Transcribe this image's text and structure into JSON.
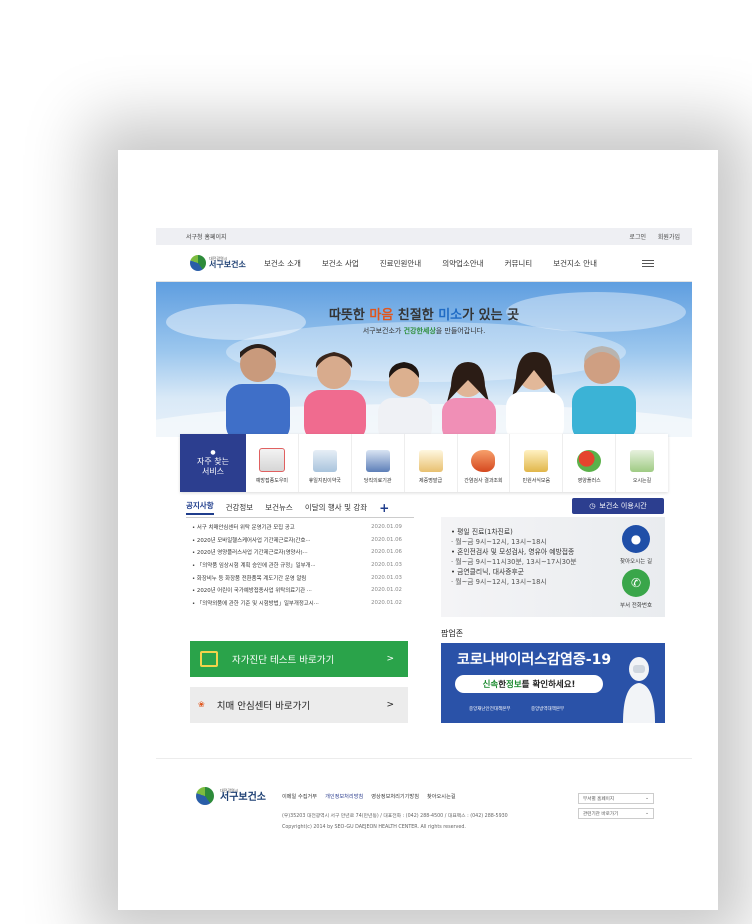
{
  "topbar": {
    "left": "서구청 홈페이지",
    "login": "로그인",
    "join": "회원가입"
  },
  "logo": {
    "small": "대전광역시",
    "name": "서구보건소"
  },
  "menu": [
    "보건소 소개",
    "보건소 사업",
    "진료민원안내",
    "의약업소안내",
    "커뮤니티",
    "보건지소 안내"
  ],
  "hero": {
    "title_a": "따뜻한 ",
    "title_b": "마음",
    "title_c": " 친절한 ",
    "title_d": "미소",
    "title_e": "가 있는 곳",
    "sub_a": "서구보건소가 ",
    "sub_b": "건강한세상",
    "sub_c": "을 만들어갑니다."
  },
  "quick": {
    "title_1": "자주 찾는",
    "title_2": "서비스",
    "items": [
      "예방접종도우미",
      "휴일지킴이약국",
      "당직의료기관",
      "제증명발급",
      "간염검사 결과조회",
      "민원서식모음",
      "영양플러스",
      "오시는길"
    ]
  },
  "tabs": [
    "공지사항",
    "건강정보",
    "보건뉴스",
    "이달의 행사 및 강좌"
  ],
  "tab_plus": "+",
  "news": [
    {
      "title": "서구 치매안심센터 위탁 운영기관 모집 공고",
      "date": "2020.01.09"
    },
    {
      "title": "2020년 모바일헬스케어사업 기간제근로자(간호···",
      "date": "2020.01.06"
    },
    {
      "title": "2020년 영양플러스사업 기간제근로자(영양사)···",
      "date": "2020.01.06"
    },
    {
      "title": "「의약품 임상시험 계획 승인에 관한 규정」일부개···",
      "date": "2020.01.03"
    },
    {
      "title": "화장비누 등 화장품 전환품목 계도기간 운영 알림",
      "date": "2020.01.03"
    },
    {
      "title": "2020년 어린이 국가예방접종사업 위탁의료기관 ···",
      "date": "2020.01.02"
    },
    {
      "title": "「의약외품에 관한 기준 및 시험방법」일부개정고시···",
      "date": "2020.01.02"
    }
  ],
  "hours": {
    "button": "보건소 이용시간",
    "l1": "• 평일 진료(1차진료)",
    "l2": "· 월~금 9시~12시, 13시~18시",
    "l3": "• 혼인전검사 및 모성검사, 영유아 예방접종",
    "l4": "· 월~금 9시~11시30분, 13시~17시30분",
    "l5": "• 금연클리닉, 대사증후군",
    "l6": "· 월~금 9시~12시, 13시~18시",
    "side1": "찾아오시는 길",
    "side2": "부서 전화번호",
    "pin_color": "#1f4fa8",
    "phone_color": "#3aa64a"
  },
  "buttons": {
    "selftest": "자가진단 테스트 바로가기",
    "dementia": "치매 안심센터 바로가기",
    "dementia_logo": "치매\n안심센터",
    "arrow": ">"
  },
  "popup": {
    "section_title": "팝업존",
    "title": "코로나바이러스감염증-19",
    "line_a": "신속",
    "line_b": "한 ",
    "line_c": "정보",
    "line_d": "를 확인하세요!",
    "org1": "중앙재난안전대책본부",
    "org2": "중앙방역대책본부"
  },
  "footer": {
    "logo_small": "대전광역시",
    "logo_name": "서구보건소",
    "links": [
      "이메일 수집거부",
      "개인정보처리방침",
      "영상정보처리기기방침",
      "찾아오시는길"
    ],
    "addr": "(우)35203 대전광역시 서구 만년로 74(만년동) / 대표전화 : (042) 288-4500 / 대표팩스 : (042) 288-5930",
    "copy": "Copyright(c) 2014 by SEO-GU DAEJEON HEALTH CENTER. All rights reserved.",
    "select1": "부서별 홈페이지",
    "select2": "관련기관 바로가기"
  },
  "colors": {
    "navy": "#2c3e8f",
    "green": "#2aa34a",
    "popup_blue": "#2a52a8"
  }
}
